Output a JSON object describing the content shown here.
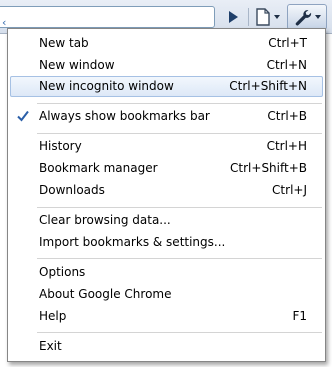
{
  "toolbar": {
    "go_icon": "play-arrow-icon",
    "page_icon": "page-menu-icon",
    "wrench_icon": "wrench-icon"
  },
  "menu": {
    "items": [
      {
        "label": "New tab",
        "accel": "Ctrl+T"
      },
      {
        "label": "New window",
        "accel": "Ctrl+N"
      },
      {
        "label": "New incognito window",
        "accel": "Ctrl+Shift+N",
        "highlighted": true
      },
      {
        "label": "Always show bookmarks bar",
        "accel": "Ctrl+B",
        "checked": true
      },
      {
        "label": "History",
        "accel": "Ctrl+H"
      },
      {
        "label": "Bookmark manager",
        "accel": "Ctrl+Shift+B"
      },
      {
        "label": "Downloads",
        "accel": "Ctrl+J"
      },
      {
        "label": "Clear browsing data...",
        "accel": ""
      },
      {
        "label": "Import bookmarks & settings...",
        "accel": ""
      },
      {
        "label": "Options",
        "accel": ""
      },
      {
        "label": "About Google Chrome",
        "accel": ""
      },
      {
        "label": "Help",
        "accel": "F1"
      },
      {
        "label": "Exit",
        "accel": ""
      }
    ]
  },
  "colors": {
    "highlight_border": "#a6c1e4",
    "highlight_fill": "#dde8f7",
    "check": "#2b5fa8",
    "icon_dark": "#1f2f46"
  }
}
